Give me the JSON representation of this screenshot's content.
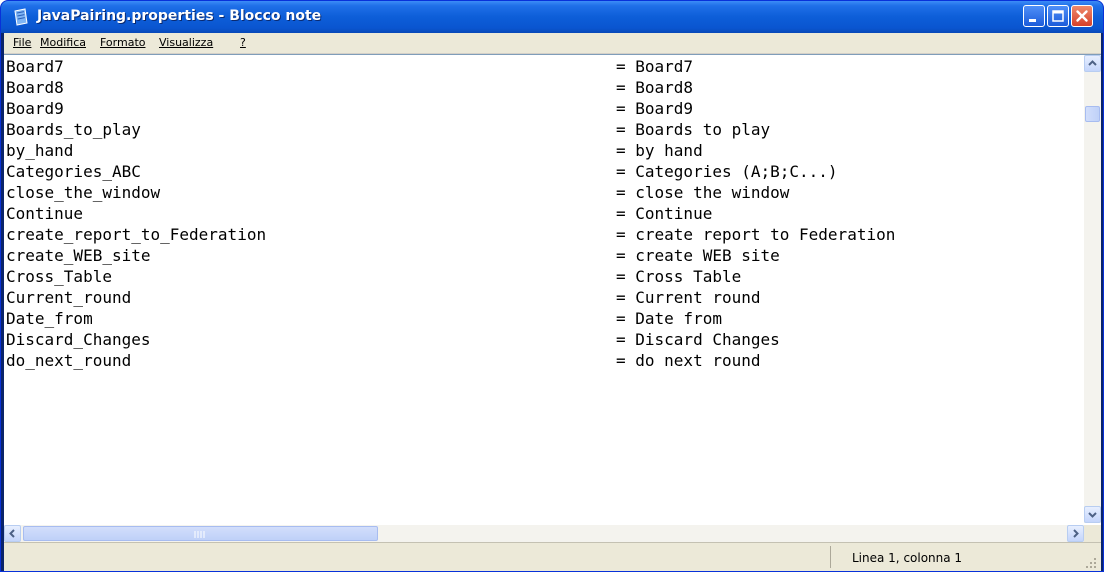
{
  "window": {
    "title": "JavaPairing.properties - Blocco note"
  },
  "menubar": {
    "items": [
      {
        "label": "File"
      },
      {
        "label": "Modifica"
      },
      {
        "label": "Formato"
      },
      {
        "label": "Visualizza"
      },
      {
        "label": "?"
      }
    ]
  },
  "editor": {
    "lines": [
      {
        "key": "Board7",
        "value": "= Board7"
      },
      {
        "key": "Board8",
        "value": "= Board8"
      },
      {
        "key": "Board9",
        "value": "= Board9"
      },
      {
        "key": "Boards_to_play",
        "value": "= Boards to play"
      },
      {
        "key": "by_hand",
        "value": "= by hand"
      },
      {
        "key": "Categories_ABC",
        "value": "= Categories (A;B;C...)"
      },
      {
        "key": "close_the_window",
        "value": "= close the window"
      },
      {
        "key": "Continue",
        "value": "= Continue"
      },
      {
        "key": "create_report_to_Federation",
        "value": "= create report to Federation"
      },
      {
        "key": "create_WEB_site",
        "value": "= create WEB site"
      },
      {
        "key": "Cross_Table",
        "value": "= Cross Table"
      },
      {
        "key": "Current_round",
        "value": "= Current round"
      },
      {
        "key": "Date_from",
        "value": "= Date from"
      },
      {
        "key": "Discard_Changes",
        "value": "= Discard Changes"
      },
      {
        "key": "do_next_round",
        "value": "= do next round"
      }
    ]
  },
  "statusbar": {
    "position": "Linea 1, colonna 1"
  },
  "icons": {
    "app": "notepad-icon",
    "minimize": "minimize-icon",
    "maximize": "maximize-icon",
    "close": "close-icon"
  },
  "colors": {
    "titlebar": "#0a55d0",
    "close_button": "#d5402a",
    "chrome": "#ece9d8"
  }
}
